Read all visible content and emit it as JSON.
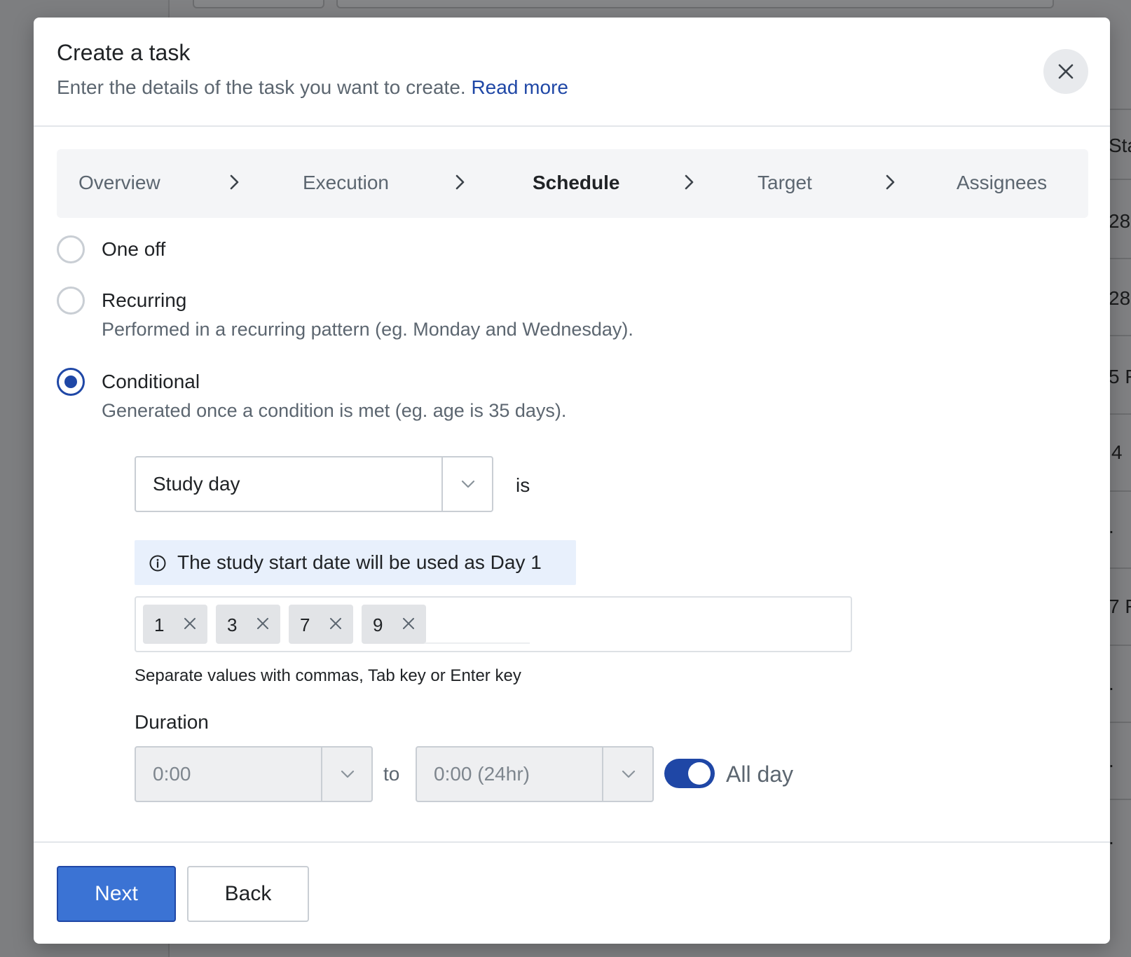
{
  "modal": {
    "title": "Create a task",
    "subtitle": "Enter the details of the task you want to create.",
    "read_more": "Read more"
  },
  "steps": [
    {
      "label": "Overview",
      "active": false
    },
    {
      "label": "Execution",
      "active": false
    },
    {
      "label": "Schedule",
      "active": true
    },
    {
      "label": "Target",
      "active": false
    },
    {
      "label": "Assignees",
      "active": false
    }
  ],
  "schedule_options": [
    {
      "label": "One off",
      "description": "",
      "checked": false
    },
    {
      "label": "Recurring",
      "description": "Performed in a recurring pattern (eg. Monday and Wednesday).",
      "checked": false
    },
    {
      "label": "Conditional",
      "description": "Generated once a condition is met (eg. age is 35 days).",
      "checked": true
    }
  ],
  "condition": {
    "field_value": "Study day",
    "operator": "is",
    "info": "The study start date will be used as Day 1",
    "tags": [
      "1",
      "3",
      "7",
      "9"
    ],
    "hint": "Separate values with commas, Tab key or Enter key"
  },
  "duration": {
    "label": "Duration",
    "start_value": "0:00",
    "to_label": "to",
    "end_value": "0:00 (24hr)",
    "all_day_label": "All day",
    "all_day_on": true
  },
  "footer": {
    "next_label": "Next",
    "back_label": "Back"
  },
  "background_fragments": [
    "Sta",
    "28",
    "28",
    "5 F",
    "4",
    ".",
    "7 F",
    ".",
    ".",
    "."
  ],
  "colors": {
    "primary": "#1f47a6",
    "primary_button": "#3b73d4",
    "info_bg": "#e8f0fc",
    "stepper_bg": "#f4f5f7"
  },
  "icons": {
    "close": "close-icon",
    "step_separator": "chevron-right-icon",
    "select_caret": "chevron-down-icon",
    "info": "info-icon",
    "tag_remove": "close-icon"
  }
}
